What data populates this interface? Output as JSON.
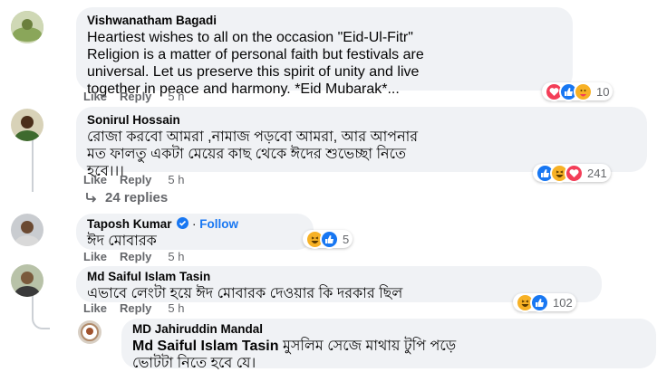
{
  "comments": [
    {
      "author": "Vishwanatham Bagadi",
      "text": "Heartiest wishes to all on the occasion \"Eid-Ul-Fitr\"\nReligion is a matter of personal faith but festivals are\nuniversal. Let us preserve this spirit of unity and live\ntogether in peace and harmony. *Eid Mubarak*...",
      "like": "Like",
      "reply": "Reply",
      "time": "5 h",
      "reaction_count": "10",
      "reactions": [
        "love-icon",
        "like-icon",
        "care-icon"
      ]
    },
    {
      "author": "Sonirul Hossain",
      "text": "রোজা করবো আমরা ,নামাজ পড়বো আমরা, আর আপনার\nমত ফালতু একটা মেয়ের কাছ থেকে ঈদের শুভেচ্ছা নিতে\nহবে।।।",
      "like": "Like",
      "reply": "Reply",
      "time": "5 h",
      "reaction_count": "241",
      "reactions": [
        "like-icon",
        "haha-icon",
        "love-icon"
      ],
      "replies_label": "24 replies"
    },
    {
      "author": "Taposh Kumar",
      "follow": "Follow",
      "text": "ঈদ মোবারক",
      "like": "Like",
      "reply": "Reply",
      "time": "5 h",
      "reaction_count": "5",
      "reactions": [
        "haha-icon",
        "like-icon"
      ]
    },
    {
      "author": "Md Saiful Islam Tasin",
      "text": "এভাবে লেংটা হয়ে ঈদ মোবারক দেওয়ার কি দরকার ছিল",
      "like": "Like",
      "reply": "Reply",
      "time": "5 h",
      "reaction_count": "102",
      "reactions": [
        "haha-icon",
        "like-icon"
      ]
    },
    {
      "author": "MD Jahiruddin Mandal",
      "mention": "Md Saiful Islam Tasin",
      "text": " মুসলিম সেজে মাথায় টুপি পড়ে\nভোটটা নিতে হবে যে।"
    }
  ],
  "colors": {
    "bubble": "#f0f2f5",
    "meta": "#65676b",
    "link": "#1877f2",
    "like": "#1877f2",
    "love": "#f33e58",
    "haha": "#f7b125"
  }
}
